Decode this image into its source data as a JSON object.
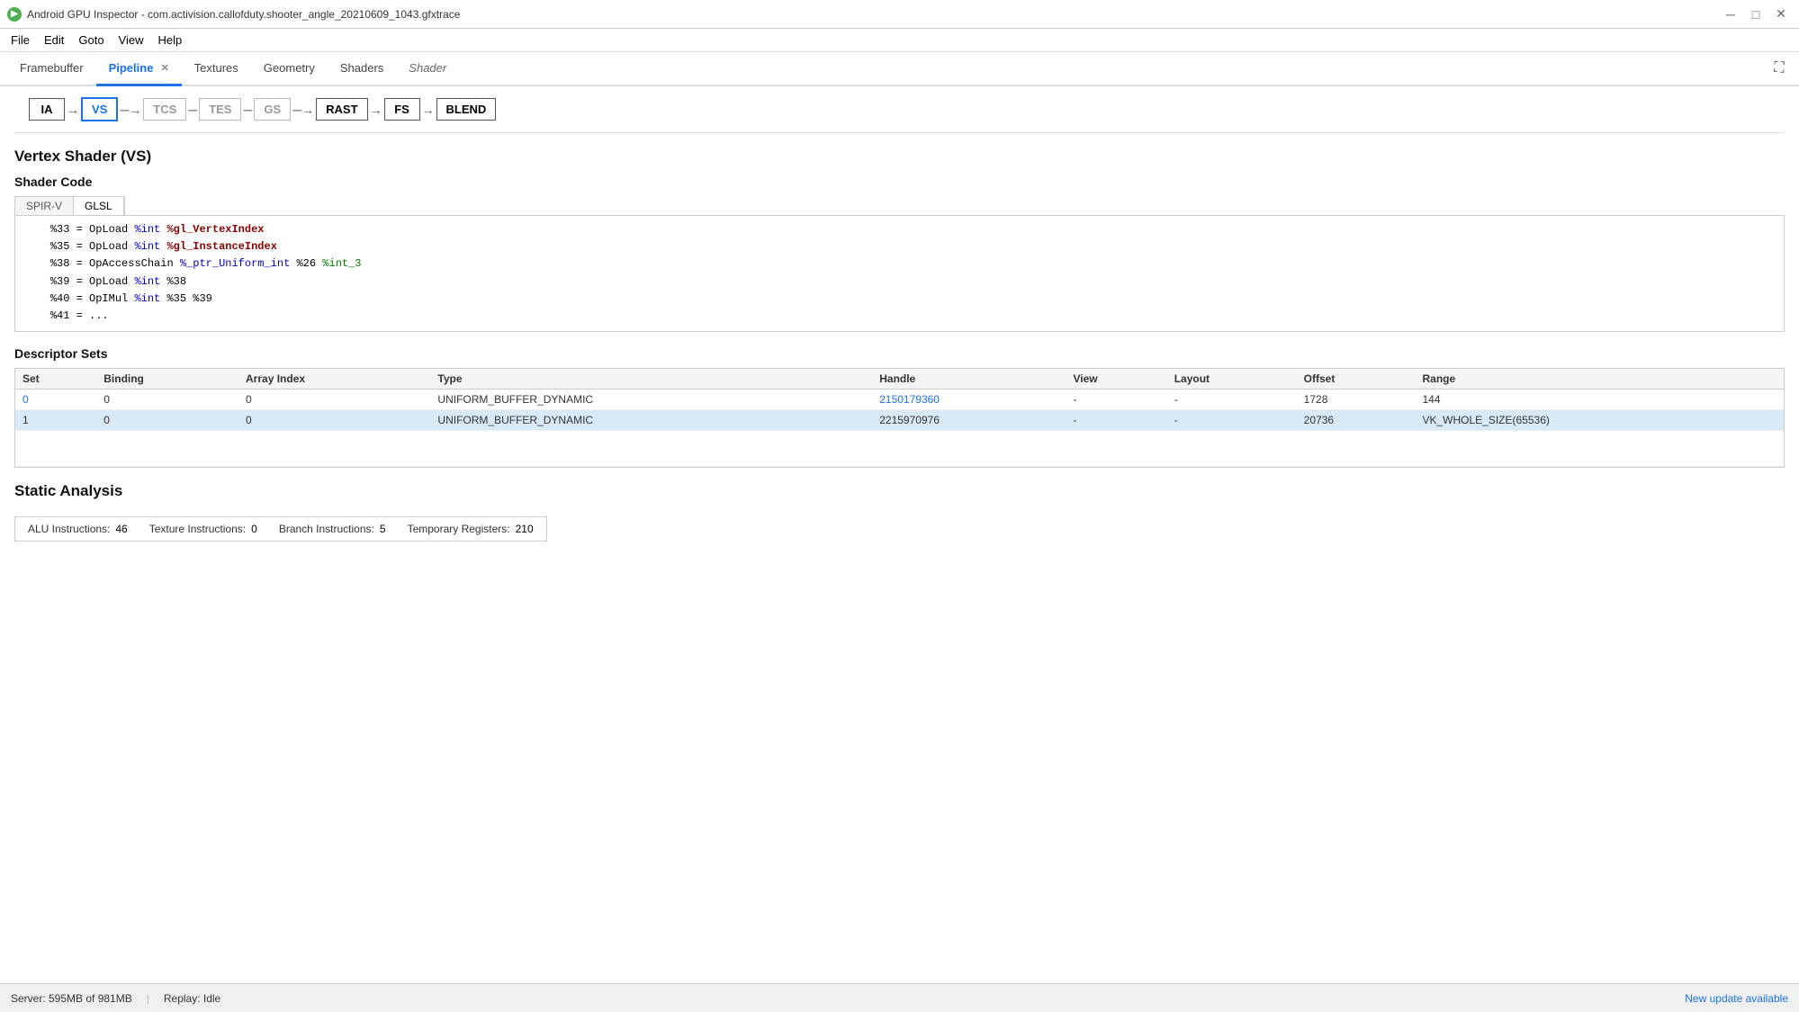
{
  "titleBar": {
    "title": "Android GPU Inspector - com.activision.callofduty.shooter_angle_20210609_1043.gfxtrace",
    "minLabel": "─",
    "maxLabel": "□",
    "closeLabel": "✕"
  },
  "menuBar": {
    "items": [
      "File",
      "Edit",
      "Goto",
      "View",
      "Help"
    ]
  },
  "tabs": [
    {
      "id": "framebuffer",
      "label": "Framebuffer",
      "active": false,
      "closable": false,
      "italic": false
    },
    {
      "id": "pipeline",
      "label": "Pipeline",
      "active": true,
      "closable": true,
      "italic": false
    },
    {
      "id": "textures",
      "label": "Textures",
      "active": false,
      "closable": false,
      "italic": false
    },
    {
      "id": "geometry",
      "label": "Geometry",
      "active": false,
      "closable": false,
      "italic": false
    },
    {
      "id": "shaders",
      "label": "Shaders",
      "active": false,
      "closable": false,
      "italic": false
    },
    {
      "id": "shader",
      "label": "Shader",
      "active": false,
      "closable": false,
      "italic": true
    }
  ],
  "pipeline": {
    "stages": [
      {
        "id": "ia",
        "label": "IA",
        "active": false,
        "dimmed": false
      },
      {
        "id": "vs",
        "label": "VS",
        "active": true,
        "dimmed": false
      },
      {
        "id": "tcs",
        "label": "TCS",
        "active": false,
        "dimmed": true
      },
      {
        "id": "tes",
        "label": "TES",
        "active": false,
        "dimmed": true
      },
      {
        "id": "gs",
        "label": "GS",
        "active": false,
        "dimmed": true
      },
      {
        "id": "rast",
        "label": "RAST",
        "active": false,
        "dimmed": false
      },
      {
        "id": "fs",
        "label": "FS",
        "active": false,
        "dimmed": false
      },
      {
        "id": "blend",
        "label": "BLEND",
        "active": false,
        "dimmed": false
      }
    ]
  },
  "vertexShader": {
    "sectionTitle": "Vertex Shader (VS)",
    "shaderCode": {
      "label": "Shader Code",
      "tabs": [
        "SPIR-V",
        "GLSL"
      ],
      "activeTab": "GLSL",
      "lines": [
        "    %33 = OpLoad %int %gl_VertexIndex",
        "    %35 = OpLoad %int %gl_InstanceIndex",
        "    %38 = OpAccessChain %_ptr_Uniform_int %26 %int_3",
        "    %39 = OpLoad %int %38",
        "    %40 = OpIMul %int %35 %39",
        "    %41 = ..."
      ]
    },
    "descriptorSets": {
      "label": "Descriptor Sets",
      "columns": [
        "Set",
        "Binding",
        "Array Index",
        "Type",
        "Handle",
        "View",
        "Layout",
        "Offset",
        "Range"
      ],
      "rows": [
        {
          "set": "0",
          "binding": "0",
          "arrayIndex": "0",
          "type": "UNIFORM_BUFFER_DYNAMIC",
          "handle": "2150179360",
          "view": "-",
          "layout": "-",
          "offset": "1728",
          "range": "144",
          "highlighted": false
        },
        {
          "set": "1",
          "binding": "0",
          "arrayIndex": "0",
          "type": "UNIFORM_BUFFER_DYNAMIC",
          "handle": "2215970976",
          "view": "-",
          "layout": "-",
          "offset": "20736",
          "range": "VK_WHOLE_SIZE(65536)",
          "highlighted": true
        }
      ]
    }
  },
  "staticAnalysis": {
    "label": "Static Analysis",
    "stats": [
      {
        "label": "ALU Instructions:",
        "value": "46"
      },
      {
        "label": "Texture Instructions:",
        "value": "0"
      },
      {
        "label": "Branch Instructions:",
        "value": "5"
      },
      {
        "label": "Temporary Registers:",
        "value": "210"
      }
    ]
  },
  "statusBar": {
    "server": "Server: 595MB of 981MB",
    "replay": "Replay: Idle",
    "updateLink": "New update available"
  }
}
